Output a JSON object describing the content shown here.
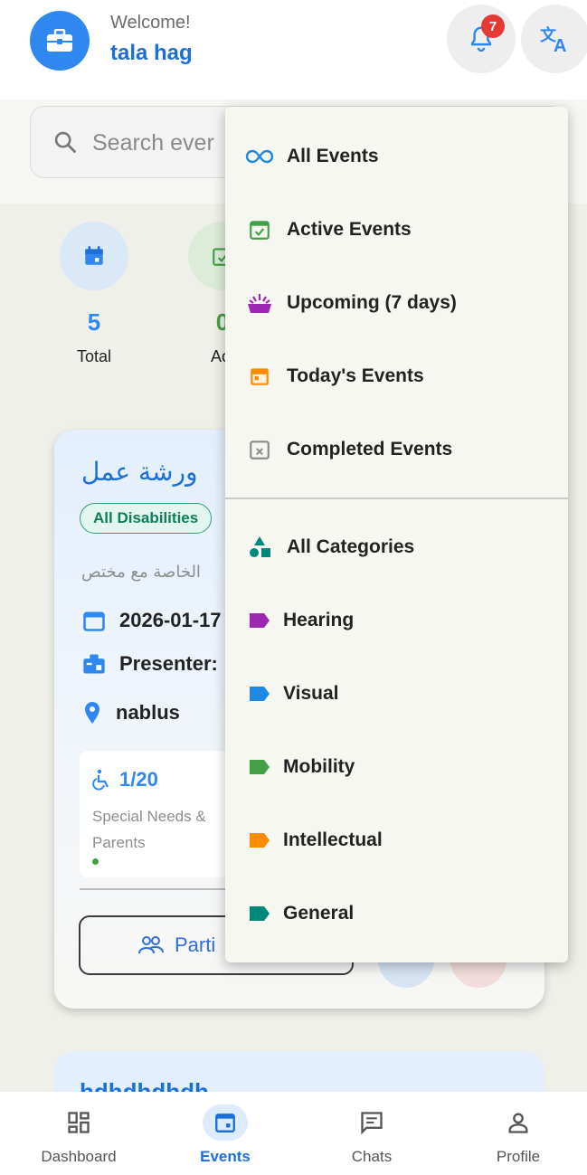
{
  "header": {
    "welcome": "Welcome!",
    "username": "tala hag",
    "notification_count": "7",
    "avatar_icon": "briefcase-icon",
    "bell_icon": "bell-icon",
    "translate_icon": "translate-icon"
  },
  "search": {
    "placeholder": "Search ever"
  },
  "stats": [
    {
      "value": "5",
      "label": "Total",
      "icon": "calendar-icon",
      "color": "#2f88ef"
    },
    {
      "value": "0",
      "label": "Act",
      "icon": "calendar-check-icon",
      "color": "#43a047"
    }
  ],
  "event_card": {
    "title": "ورشة عمل",
    "category_pill": "All Disabilities",
    "description": "الخاصة مع مختص",
    "date": "2026-01-17",
    "presenter_label": "Presenter:",
    "location": "nablus",
    "participants_count": "1/20",
    "participants_text": "Special Needs & Parents",
    "participants_button": "Parti"
  },
  "second_card": {
    "title": "hdhdhdhdh"
  },
  "dropdown": {
    "status_items": [
      {
        "label": "All Events",
        "icon": "infinity-icon",
        "color": "#1e88e5"
      },
      {
        "label": "Active Events",
        "icon": "calendar-check-icon",
        "color": "#43a047"
      },
      {
        "label": "Upcoming (7 days)",
        "icon": "party-icon",
        "color": "#9c27b0"
      },
      {
        "label": "Today's Events",
        "icon": "calendar-today-icon",
        "color": "#fb8c00"
      },
      {
        "label": "Completed Events",
        "icon": "calendar-x-icon",
        "color": "#8a8a8a"
      }
    ],
    "category_items": [
      {
        "label": "All Categories",
        "icon": "shapes-icon",
        "color": "#00897b"
      },
      {
        "label": "Hearing",
        "icon": "label-icon",
        "color": "#9c27b0"
      },
      {
        "label": "Visual",
        "icon": "label-icon",
        "color": "#1e88e5"
      },
      {
        "label": "Mobility",
        "icon": "label-icon",
        "color": "#43a047"
      },
      {
        "label": "Intellectual",
        "icon": "label-icon",
        "color": "#fb8c00"
      },
      {
        "label": "General",
        "icon": "label-icon",
        "color": "#00897b"
      }
    ]
  },
  "bottom_nav": {
    "items": [
      {
        "label": "Dashboard",
        "icon": "dashboard-icon"
      },
      {
        "label": "Events",
        "icon": "calendar-icon",
        "active": true
      },
      {
        "label": "Chats",
        "icon": "chat-icon"
      },
      {
        "label": "Profile",
        "icon": "person-icon"
      }
    ]
  },
  "colors": {
    "primary": "#1d6fd8",
    "accent": "#2f88ef",
    "badge": "#e53935"
  }
}
